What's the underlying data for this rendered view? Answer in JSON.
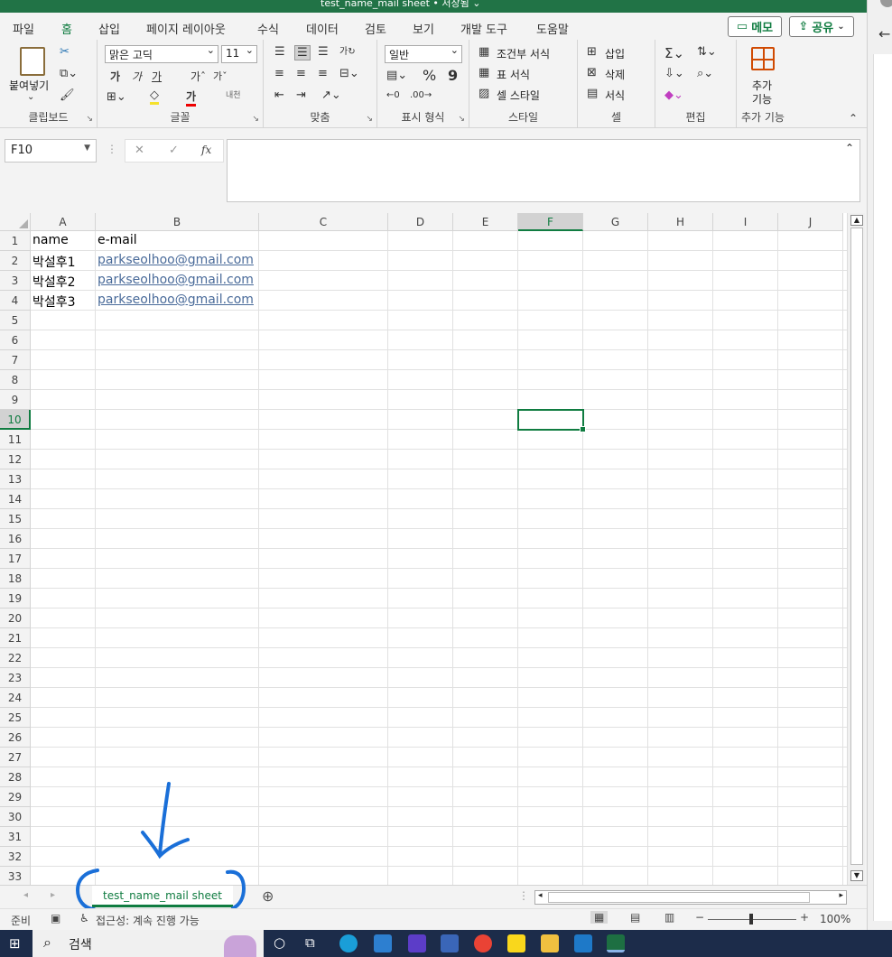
{
  "window": {
    "title": "test_name_mail sheet • 저장됨 ⌄"
  },
  "menu": {
    "tabs": [
      "파일",
      "홈",
      "삽입",
      "페이지 레이아웃",
      "수식",
      "데이터",
      "검토",
      "보기",
      "개발 도구",
      "도움말"
    ],
    "memo_label": "메모",
    "share_label": "공유"
  },
  "ribbon": {
    "clipboard": {
      "paste_label": "붙여넣기",
      "group_label": "클립보드"
    },
    "font": {
      "font_name": "맑은 고딕",
      "font_size": "11",
      "group_label": "글꼴",
      "bold": "가",
      "italic": "가",
      "underline": "가",
      "grow": "가ˆ",
      "shrink": "가ˇ",
      "color_char": "가"
    },
    "alignment": {
      "group_label": "맞춤"
    },
    "number": {
      "format": "일반",
      "percent": "%",
      "comma": "9",
      "group_label": "표시 형식"
    },
    "styles": {
      "conditional": "조건부 서식",
      "table": "표 서식",
      "cell_styles": "셀 스타일",
      "group_label": "스타일"
    },
    "cells": {
      "insert": "삽입",
      "delete": "삭제",
      "format": "서식",
      "group_label": "셀"
    },
    "editing": {
      "group_label": "편집"
    },
    "addins": {
      "label1": "추가",
      "label2": "기능",
      "group_label": "추가 기능"
    }
  },
  "formula_bar": {
    "name_box": "F10",
    "fx": "fx",
    "cancel": "✕",
    "enter": "✓",
    "formula": ""
  },
  "sheet": {
    "columns": [
      "A",
      "B",
      "C",
      "D",
      "E",
      "F",
      "G",
      "H",
      "I",
      "J"
    ],
    "selected_column": "F",
    "selected_row": "10",
    "rows": [
      "1",
      "2",
      "3",
      "4",
      "5",
      "6",
      "7",
      "8",
      "9",
      "10",
      "11",
      "12",
      "13",
      "14",
      "15",
      "16",
      "17",
      "18",
      "19",
      "20",
      "21",
      "22",
      "23",
      "24",
      "25",
      "26",
      "27",
      "28",
      "29",
      "30",
      "31",
      "32",
      "33"
    ],
    "data": [
      {
        "a": "name",
        "b": "e-mail"
      },
      {
        "a": "박설후1",
        "b": "parkseolhoo@gmail.com"
      },
      {
        "a": "박설후2",
        "b": "parkseolhoo@gmail.com"
      },
      {
        "a": "박설후3",
        "b": "parkseolhoo@gmail.com"
      }
    ]
  },
  "sheet_tabs": {
    "active": "test_name_mail sheet",
    "add": "⊕"
  },
  "status": {
    "ready": "준비",
    "accessibility": "접근성: 계속 진행 가능",
    "zoom": "100%"
  },
  "taskbar": {
    "search": "검색"
  },
  "colors": {
    "accent": "#107c41",
    "annotation": "#1a6fd8",
    "link": "#4a6b9a"
  }
}
